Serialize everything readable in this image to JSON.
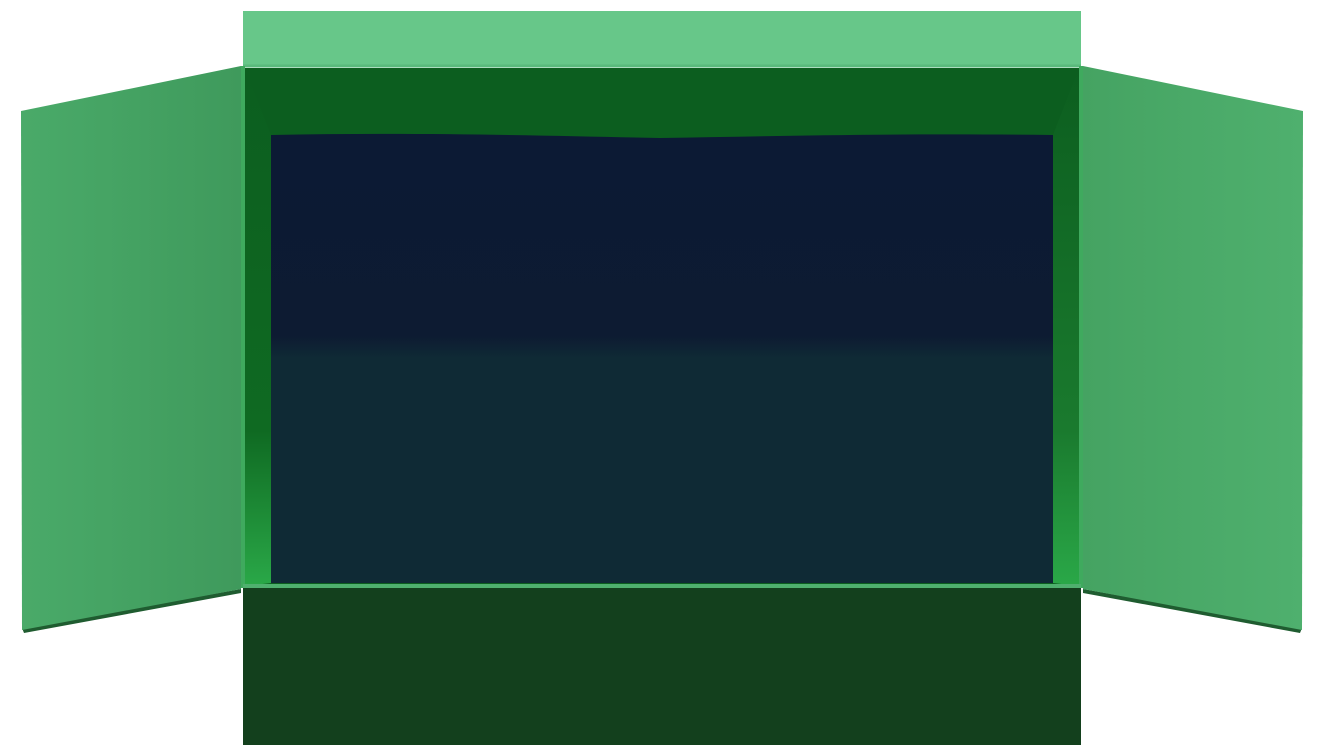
{
  "scene": {
    "object": "open-box",
    "colors": {
      "background": "#ffffff",
      "back_flap": "#67c789",
      "back_flap_edge": "#5aba7c",
      "left_flap_light": "#4aaa69",
      "left_flap_dark": "#3f9a5c",
      "right_flap_light": "#4fb06e",
      "right_flap_dark": "#45a362",
      "flap_shadow": "#1f5c30",
      "inner_top": "#0c5e1f",
      "inner_side_left": "#0f6a22",
      "inner_side_right": "#1a7a2e",
      "inner_side_bright": "#2aa848",
      "rim": "#3faa5e",
      "interior_top": "#0c1a34",
      "interior_bottom": "#0f2a35",
      "front_panel": "#13401d"
    }
  }
}
